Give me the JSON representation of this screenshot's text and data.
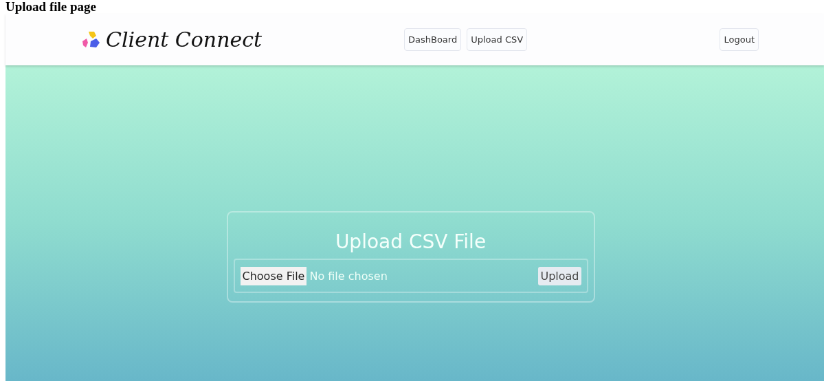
{
  "caption": "Upload file page",
  "navbar": {
    "brand": "Client Connect",
    "links": [
      {
        "label": "DashBoard"
      },
      {
        "label": "Upload CSV"
      }
    ],
    "logout": "Logout"
  },
  "upload_card": {
    "title": "Upload CSV File",
    "choose_button": "Choose File",
    "file_status": "No file chosen",
    "upload_button": "Upload"
  }
}
